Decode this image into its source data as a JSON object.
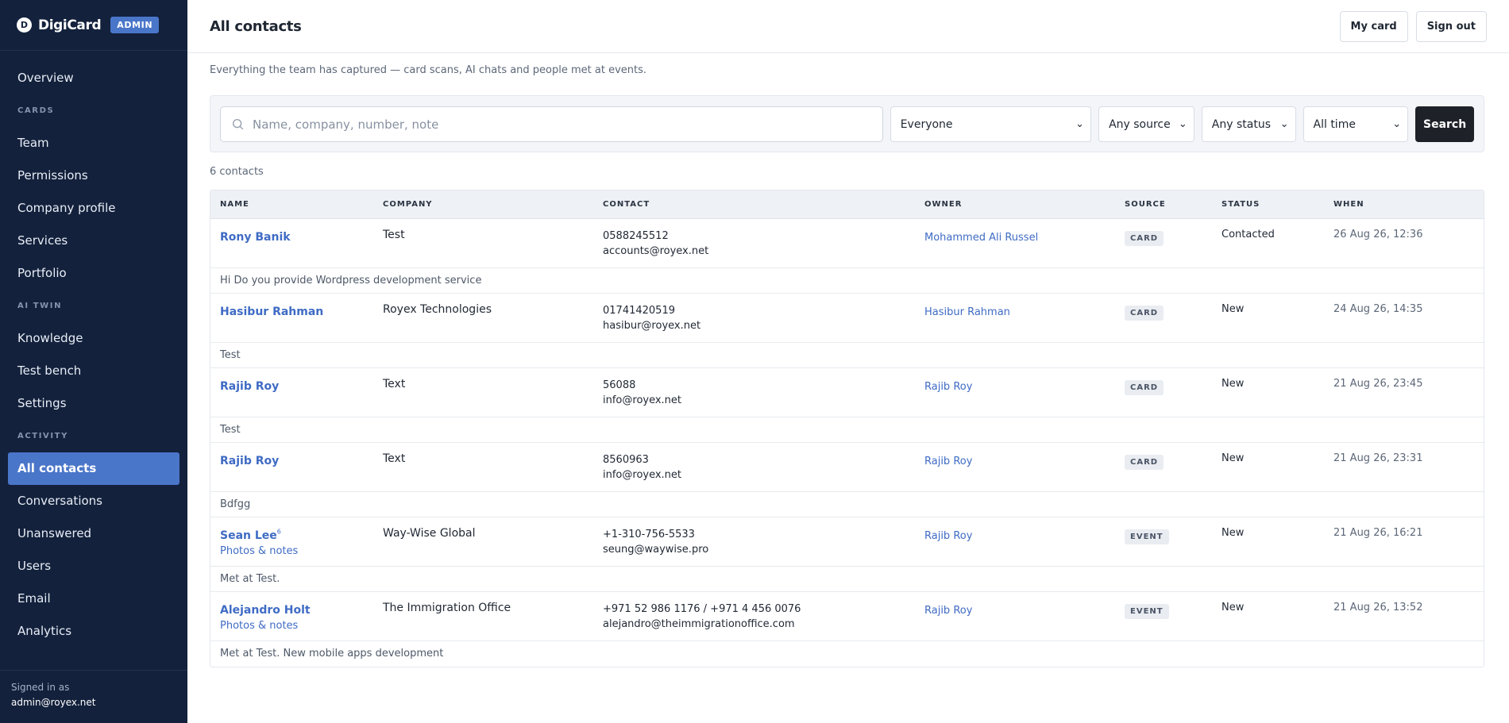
{
  "brand": {
    "logo_letter": "D",
    "name": "DigiCard",
    "badge": "ADMIN"
  },
  "sidebar": {
    "overview": "Overview",
    "section_cards": "CARDS",
    "team": "Team",
    "permissions": "Permissions",
    "company_profile": "Company profile",
    "services": "Services",
    "portfolio": "Portfolio",
    "section_ai_twin": "AI TWIN",
    "knowledge": "Knowledge",
    "test_bench": "Test bench",
    "settings": "Settings",
    "section_activity": "ACTIVITY",
    "all_contacts": "All contacts",
    "conversations": "Conversations",
    "unanswered": "Unanswered",
    "users": "Users",
    "email": "Email",
    "analytics": "Analytics",
    "signed_in_label": "Signed in as",
    "signed_in_email": "admin@royex.net"
  },
  "header": {
    "title": "All contacts",
    "my_card": "My card",
    "sign_out": "Sign out",
    "subtitle": "Everything the team has captured — card scans, AI chats and people met at events."
  },
  "filters": {
    "search_placeholder": "Name, company, number, note",
    "owner": "Everyone",
    "source": "Any source",
    "status": "Any status",
    "time": "All time",
    "search_button": "Search"
  },
  "count_text": "6 contacts",
  "table": {
    "headers": {
      "name": "NAME",
      "company": "COMPANY",
      "contact": "CONTACT",
      "owner": "OWNER",
      "source": "SOURCE",
      "status": "STATUS",
      "when": "WHEN"
    },
    "rows": [
      {
        "name": "Rony Banik",
        "sub": "",
        "company": "Test",
        "phone": "0588245512",
        "email": "accounts@royex.net",
        "owner": "Mohammed Ali Russel",
        "source": "CARD",
        "status": "Contacted",
        "when": "26 Aug 26, 12:36",
        "note": "Hi Do you provide Wordpress development service"
      },
      {
        "name": "Hasibur Rahman",
        "sub": "",
        "company": "Royex Technologies",
        "phone": "01741420519",
        "email": "hasibur@royex.net",
        "owner": "Hasibur Rahman",
        "source": "CARD",
        "status": "New",
        "when": "24 Aug 26, 14:35",
        "note": "Test"
      },
      {
        "name": "Rajib Roy",
        "sub": "",
        "company": "Text",
        "phone": "56088",
        "email": "info@royex.net",
        "owner": "Rajib Roy",
        "source": "CARD",
        "status": "New",
        "when": "21 Aug 26, 23:45",
        "note": "Test"
      },
      {
        "name": "Rajib Roy",
        "sub": "",
        "company": "Text",
        "phone": "8560963",
        "email": "info@royex.net",
        "owner": "Rajib Roy",
        "source": "CARD",
        "status": "New",
        "when": "21 Aug 26, 23:31",
        "note": "Bdfgg"
      },
      {
        "name": "Sean Lee",
        "name_sup": "6",
        "sub": "Photos & notes",
        "company": "Way-Wise Global",
        "phone": "+1-310-756-5533",
        "email": "seung@waywise.pro",
        "owner": "Rajib Roy",
        "source": "EVENT",
        "status": "New",
        "when": "21 Aug 26, 16:21",
        "note": "Met at Test."
      },
      {
        "name": "Alejandro Holt",
        "sub": "Photos & notes",
        "company": "The Immigration Office",
        "phone": "+971 52 986 1176 / +971 4 456 0076",
        "email": "alejandro@theimmigrationoffice.com",
        "owner": "Rajib Roy",
        "source": "EVENT",
        "status": "New",
        "when": "21 Aug 26, 13:52",
        "note": "Met at Test. New mobile apps development"
      }
    ]
  }
}
